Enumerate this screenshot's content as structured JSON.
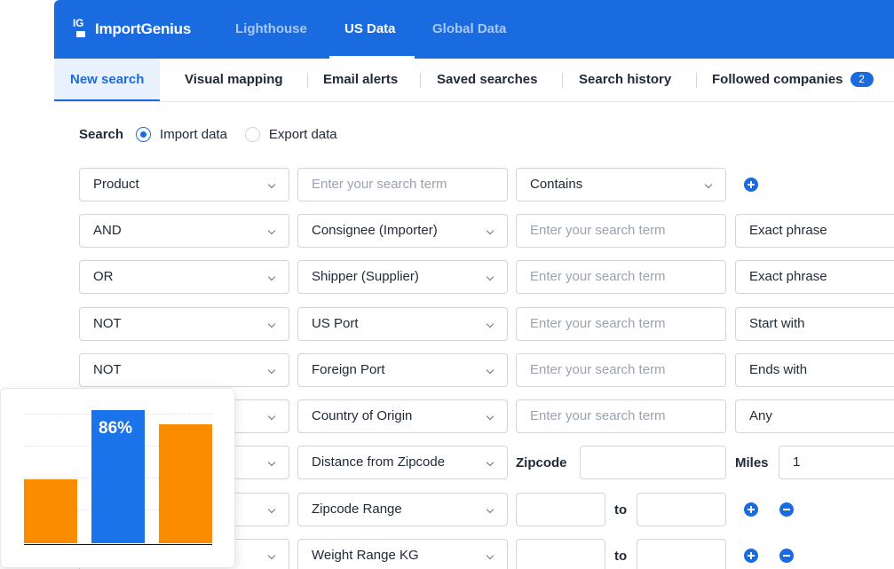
{
  "brand": {
    "name": "ImportGenius",
    "mark": "IG"
  },
  "topnav": [
    "Lighthouse",
    "US Data",
    "Global Data"
  ],
  "subnav": {
    "tabs": [
      "New search",
      "Visual mapping",
      "Email alerts",
      "Saved searches",
      "Search history",
      "Followed companies"
    ],
    "followed_count": "2"
  },
  "search_type": {
    "label": "Search",
    "options": [
      "Import data",
      "Export data"
    ],
    "selected": "Import data"
  },
  "placeholder": "Enter your search term",
  "rows": [
    {
      "op": "Product",
      "term_ph": "Enter your search term",
      "match": "Contains"
    },
    {
      "op": "AND",
      "field": "Consignee (Importer)",
      "term_ph": "Enter your search term",
      "match": "Exact phrase"
    },
    {
      "op": "OR",
      "field": "Shipper (Supplier)",
      "term_ph": "Enter your search term",
      "match": "Exact phrase"
    },
    {
      "op": "NOT",
      "field": "US Port",
      "term_ph": "Enter your search term",
      "match": "Start with"
    },
    {
      "op": "NOT",
      "field": "Foreign Port",
      "term_ph": "Enter your search term",
      "match": "Ends with"
    },
    {
      "field": "Country of Origin",
      "term_ph": "Enter your search term",
      "match": "Any"
    },
    {
      "field": "Distance from Zipcode",
      "zip_label": "Zipcode",
      "miles_label": "Miles",
      "miles_value": "1"
    },
    {
      "field": "Zipcode Range",
      "to_label": "to"
    },
    {
      "field": "Weight Range KG",
      "to_label": "to"
    }
  ],
  "chart_data": {
    "type": "bar",
    "categories": [
      "",
      "",
      ""
    ],
    "values": [
      48,
      100,
      89
    ],
    "colors": [
      "#fb8c00",
      "#1a73e8",
      "#fb8c00"
    ],
    "labels": [
      "",
      "86%",
      ""
    ],
    "ylim": [
      0,
      100
    ]
  }
}
